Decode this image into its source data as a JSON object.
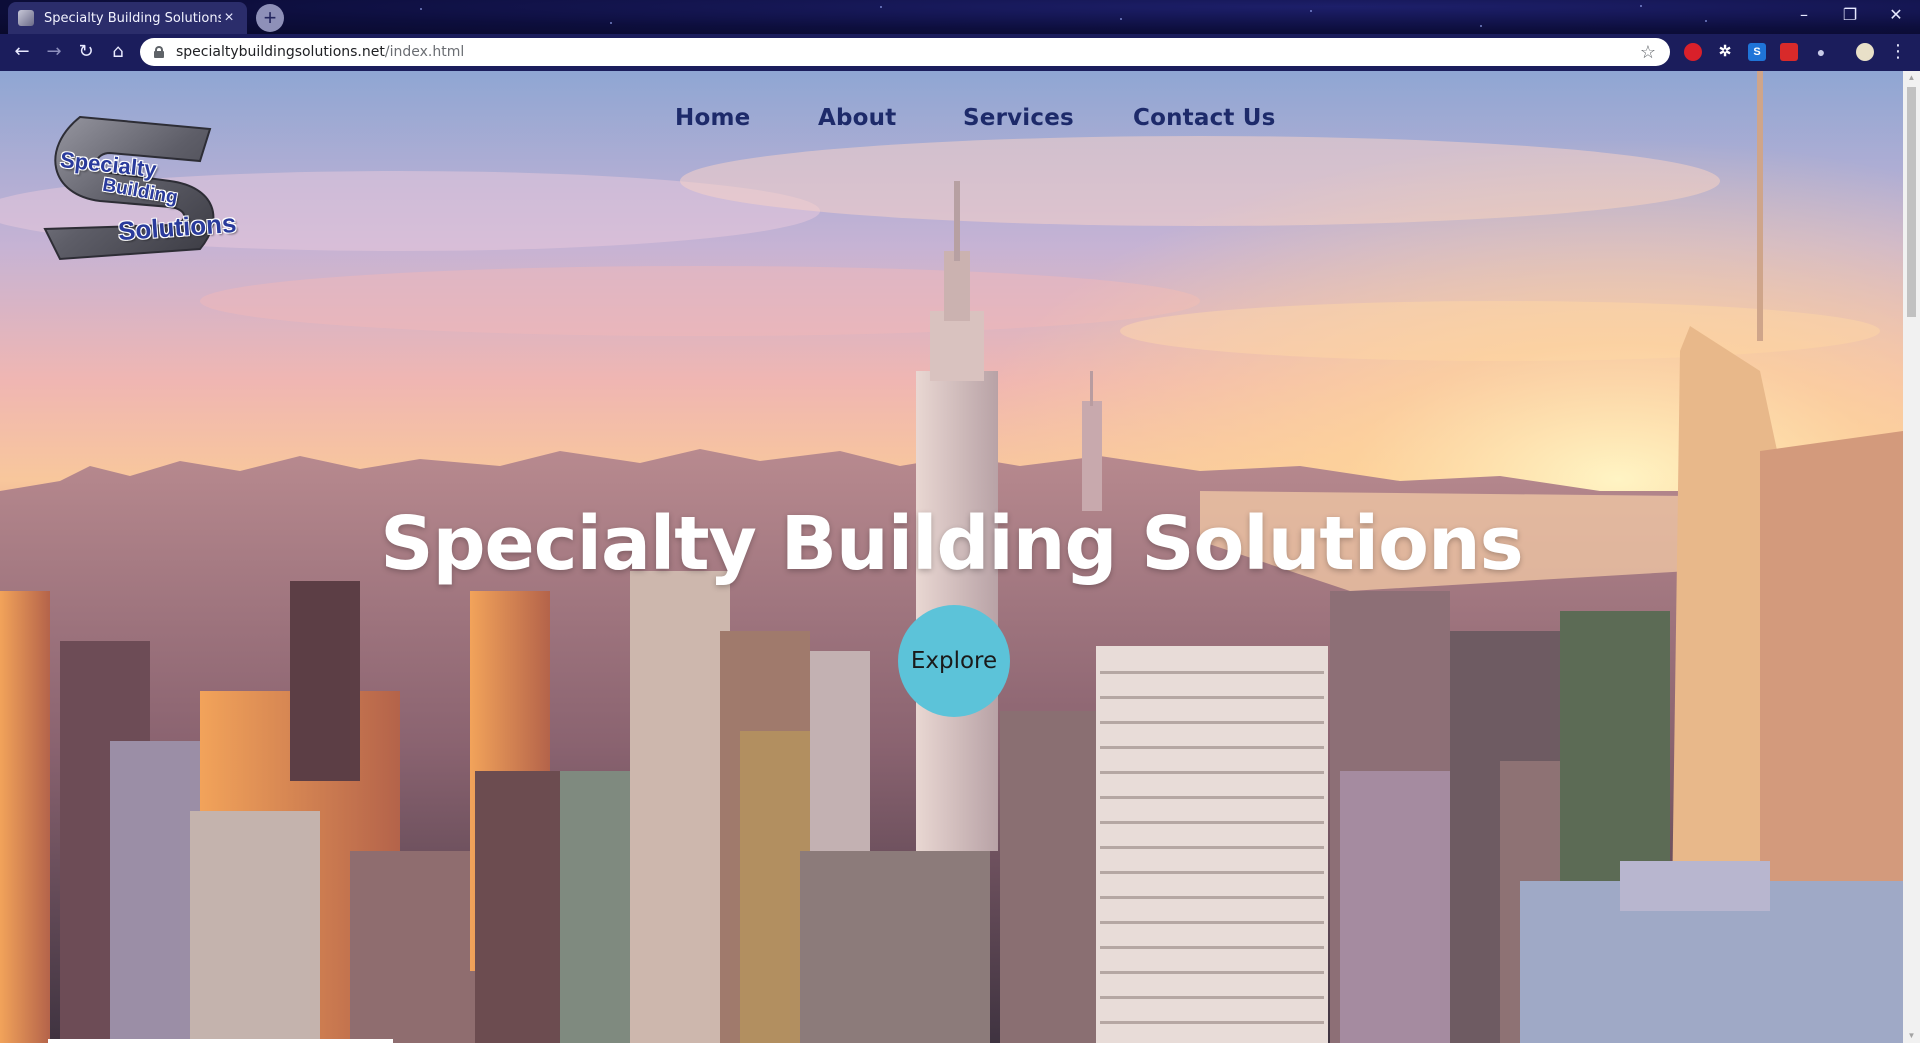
{
  "browser": {
    "tab_title": "Specialty Building Solutions",
    "tab_close": "×",
    "new_tab": "+",
    "url_host": "specialtybuildingsolutions.net",
    "url_path": "/index.html",
    "window_controls": {
      "minimize": "–",
      "restore": "❐",
      "close": "✕"
    },
    "nav": {
      "back": "←",
      "forward": "→",
      "reload": "↻",
      "home": "⌂"
    },
    "bookmark_star": "☆",
    "menu": "⋮"
  },
  "site": {
    "logo": {
      "line1": "Specialty",
      "line2": "Building",
      "line3": "Solutions"
    },
    "nav": [
      {
        "label": "Home"
      },
      {
        "label": "About"
      },
      {
        "label": "Services"
      },
      {
        "label": "Contact Us"
      }
    ],
    "hero_title": "Specialty Building Solutions",
    "cta_label": "Explore"
  },
  "colors": {
    "nav_text": "#1d2a6a",
    "cta_bg": "#5cc3d9",
    "chrome_bg": "#1b1d5c"
  }
}
